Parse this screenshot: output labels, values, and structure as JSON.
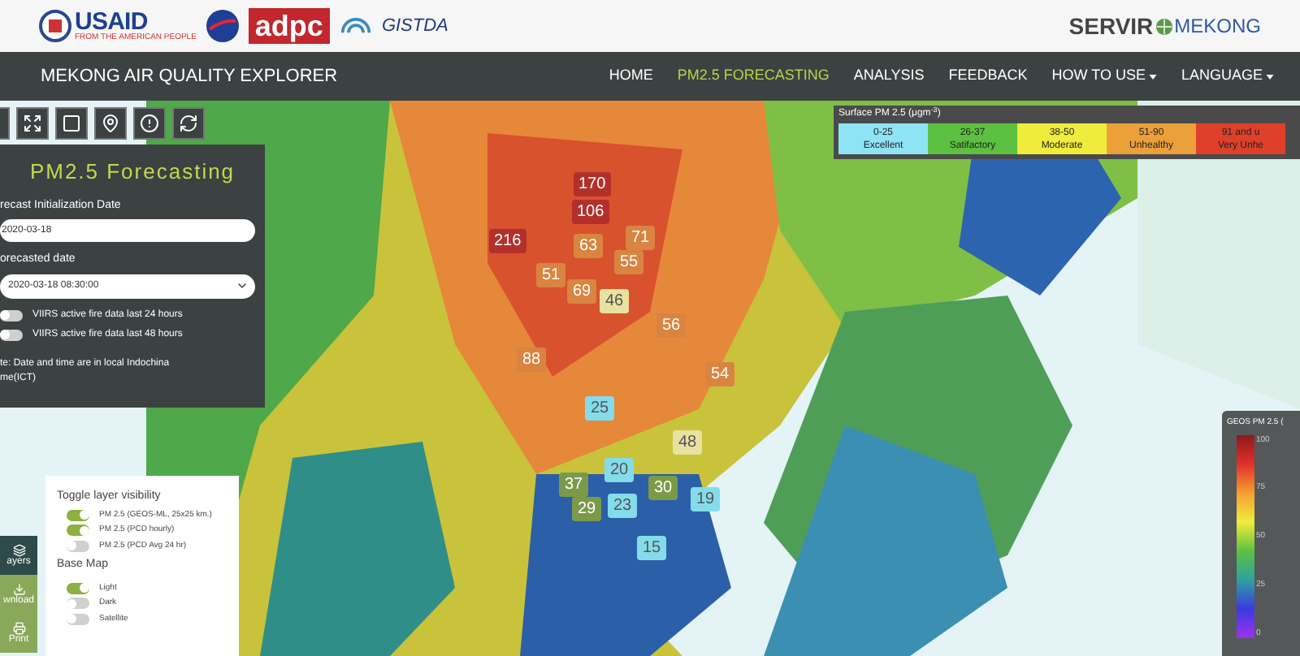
{
  "header": {
    "logos": [
      {
        "kind": "usaid",
        "text": "USAID",
        "subtext": "FROM THE AMERICAN PEOPLE"
      },
      {
        "kind": "nasa"
      },
      {
        "kind": "adpc",
        "text": "adpc"
      },
      {
        "kind": "arch"
      },
      {
        "kind": "gistda",
        "text": "GISTDA"
      }
    ],
    "brand": {
      "left": "SERVIR",
      "right": "MEKONG"
    }
  },
  "navbar": {
    "title": "MEKONG AIR QUALITY EXPLORER",
    "items": [
      {
        "label": "HOME",
        "selected": false,
        "dropdown": false
      },
      {
        "label": "PM2.5 FORECASTING",
        "selected": true,
        "dropdown": false
      },
      {
        "label": "ANALYSIS",
        "selected": false,
        "dropdown": false
      },
      {
        "label": "FEEDBACK",
        "selected": false,
        "dropdown": false
      },
      {
        "label": "HOW TO USE",
        "selected": false,
        "dropdown": true
      },
      {
        "label": "LANGUAGE",
        "selected": false,
        "dropdown": true
      }
    ]
  },
  "toolbar": [
    {
      "kind": "expand"
    },
    {
      "kind": "square"
    },
    {
      "kind": "pin"
    },
    {
      "kind": "alert"
    },
    {
      "kind": "refresh"
    }
  ],
  "panel": {
    "title": "PM2.5 Forecasting",
    "init_label": "recast Initialization Date",
    "init_value": "2020-03-18",
    "forecast_label": "orecasted date",
    "forecast_value": "2020-03-18 08:30:00",
    "toggles": [
      {
        "label": "VIIRS active fire data last 24 hours",
        "on": false
      },
      {
        "label": "VIIRS active fire data last 48 hours",
        "on": false
      }
    ],
    "note": "te: Date and time are in local Indochina\nme(ICT)"
  },
  "legend": {
    "title": "Surface PM 2.5 (μgm$^{-3}$)",
    "classes": [
      {
        "range": "0-25",
        "label": "Excellent",
        "color": "#8ee3f5"
      },
      {
        "range": "26-37",
        "label": "Satifactory",
        "color": "#5cc040"
      },
      {
        "range": "38-50",
        "label": "Moderate",
        "color": "#f0ec3c"
      },
      {
        "range": "51-90",
        "label": "Unhealthy",
        "color": "#eba03a"
      },
      {
        "range": "91 and u",
        "label": "Very Unhe",
        "color": "#e0402a"
      }
    ]
  },
  "markers": [
    {
      "value": "170",
      "color": "#b3302a"
    },
    {
      "value": "106",
      "color": "#b3302a"
    },
    {
      "value": "216",
      "color": "#b3302a"
    },
    {
      "value": "63",
      "color": "#d98440"
    },
    {
      "value": "71",
      "color": "#d98440"
    },
    {
      "value": "51",
      "color": "#d98440"
    },
    {
      "value": "55",
      "color": "#d98440"
    },
    {
      "value": "69",
      "color": "#d98440"
    },
    {
      "value": "46",
      "color": "#e8e2a0"
    },
    {
      "value": "56",
      "color": "#d98440"
    },
    {
      "value": "88",
      "color": "#d98440"
    },
    {
      "value": "54",
      "color": "#d98440"
    },
    {
      "value": "25",
      "color": "#84dceb"
    },
    {
      "value": "48",
      "color": "#e8e2a0"
    },
    {
      "value": "20",
      "color": "#84dceb"
    },
    {
      "value": "37",
      "color": "#7a9a4a"
    },
    {
      "value": "29",
      "color": "#7a9a4a"
    },
    {
      "value": "23",
      "color": "#84dceb"
    },
    {
      "value": "30",
      "color": "#7a9a4a"
    },
    {
      "value": "19",
      "color": "#84dceb"
    },
    {
      "value": "15",
      "color": "#84dceb"
    }
  ],
  "side_buttons": [
    {
      "label": "ayers",
      "kind": "layers",
      "selected": true
    },
    {
      "label": "wnload",
      "kind": "download",
      "selected": false
    },
    {
      "label": "Print",
      "kind": "print",
      "selected": false
    }
  ],
  "layers": {
    "title": "Toggle layer visibility",
    "items": [
      {
        "label": "PM 2.5 (GEOS-ML, 25x25 km.)",
        "on": true
      },
      {
        "label": "PM 2.5 (PCD hourly)",
        "on": true
      },
      {
        "label": "PM 2.5 (PCD Avg 24 hr)",
        "on": false
      }
    ],
    "basemap_title": "Base Map",
    "basemaps": [
      {
        "label": "Light",
        "on": true
      },
      {
        "label": "Dark",
        "on": false
      },
      {
        "label": "Satellite",
        "on": false
      }
    ]
  },
  "colorbar": {
    "title": "GEOS PM 2.5 (",
    "ticks": [
      "100",
      "75",
      "50",
      "25",
      "0"
    ]
  }
}
